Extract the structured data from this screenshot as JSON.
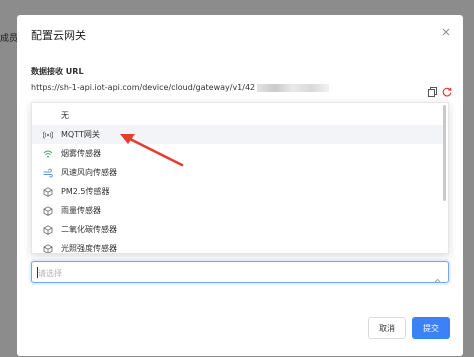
{
  "background": {
    "member_label": "成员"
  },
  "modal": {
    "title": "配置云网关",
    "url_label": "数据接收 URL",
    "url_value": "https://sh-1-api.iot-api.com/device/cloud/gateway/v1/42"
  },
  "dropdown": {
    "items": [
      {
        "label": "无",
        "icon": "none"
      },
      {
        "label": "MQTT网关",
        "icon": "broadcast-icon"
      },
      {
        "label": "烟雾传感器",
        "icon": "wifi-icon"
      },
      {
        "label": "风速风向传感器",
        "icon": "wind-icon"
      },
      {
        "label": "PM2.5传感器",
        "icon": "cube-icon"
      },
      {
        "label": "雨量传感器",
        "icon": "cube-icon"
      },
      {
        "label": "二氧化碳传感器",
        "icon": "cube-icon"
      },
      {
        "label": "光照强度传感器",
        "icon": "cube-icon"
      }
    ],
    "active_index": 1
  },
  "select": {
    "placeholder": "请选择"
  },
  "footer": {
    "cancel_label": "取消",
    "submit_label": "提交"
  },
  "colors": {
    "primary": "#3b82f6",
    "annotation_arrow": "#e53e2e",
    "refresh": "#e53e2e"
  }
}
